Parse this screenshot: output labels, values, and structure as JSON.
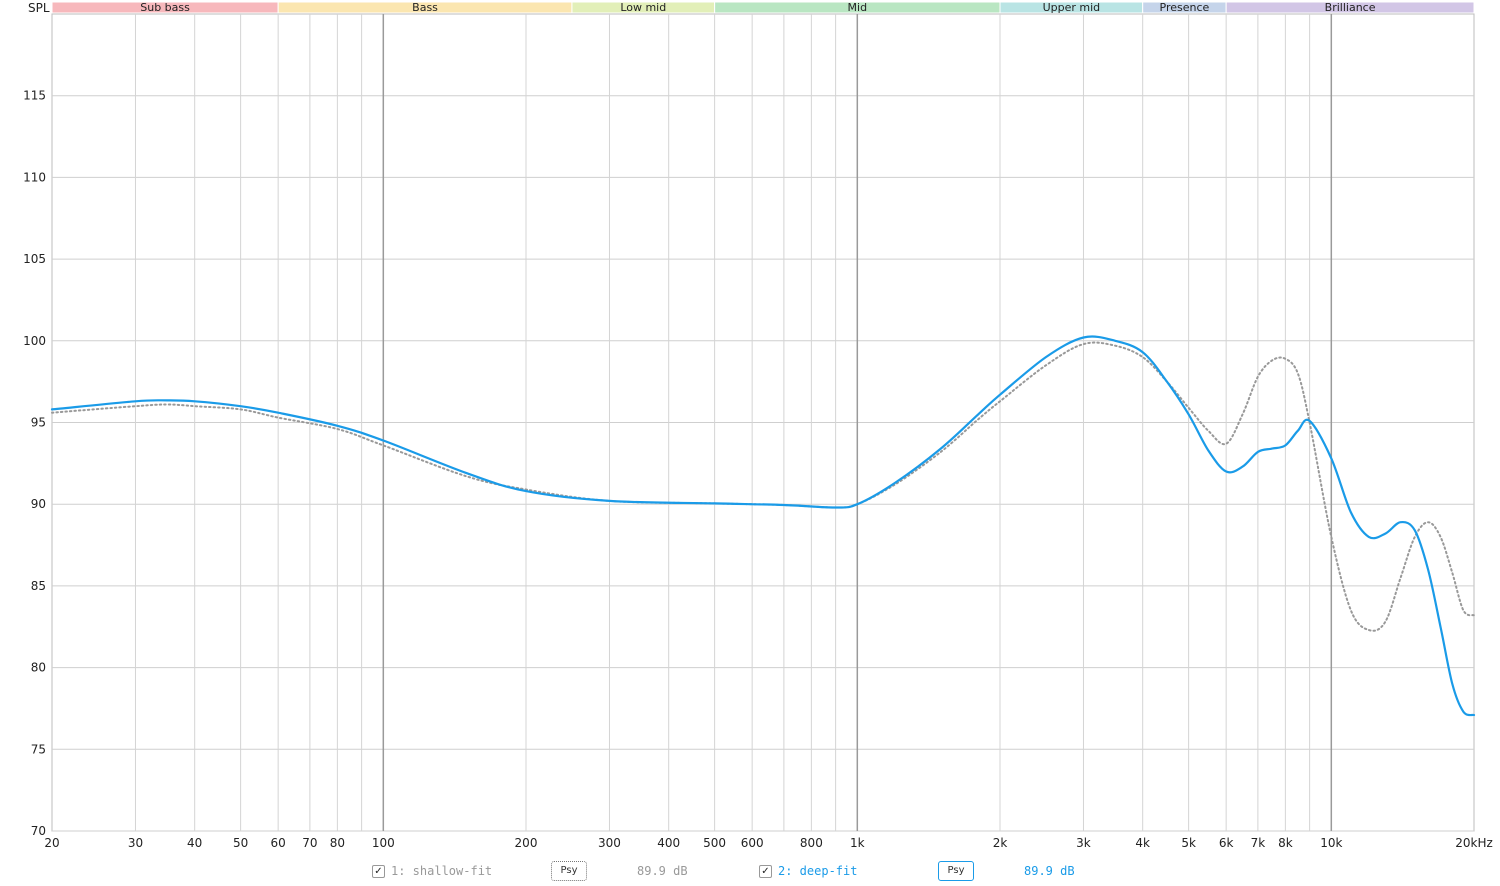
{
  "chart_data": {
    "type": "line",
    "ylabel": "SPL",
    "x_scale": "log",
    "xlim": [
      20,
      20000
    ],
    "ylim": [
      70,
      120
    ],
    "grid": true,
    "y_ticks": [
      70,
      75,
      80,
      85,
      90,
      95,
      100,
      105,
      110,
      115
    ],
    "x_ticks": [
      {
        "value": 20,
        "label": "20"
      },
      {
        "value": 30,
        "label": "30"
      },
      {
        "value": 40,
        "label": "40"
      },
      {
        "value": 50,
        "label": "50"
      },
      {
        "value": 60,
        "label": "60"
      },
      {
        "value": 70,
        "label": "70"
      },
      {
        "value": 80,
        "label": "80"
      },
      {
        "value": 100,
        "label": "100"
      },
      {
        "value": 200,
        "label": "200"
      },
      {
        "value": 300,
        "label": "300"
      },
      {
        "value": 400,
        "label": "400"
      },
      {
        "value": 500,
        "label": "500"
      },
      {
        "value": 600,
        "label": "600"
      },
      {
        "value": 800,
        "label": "800"
      },
      {
        "value": 1000,
        "label": "1k"
      },
      {
        "value": 2000,
        "label": "2k"
      },
      {
        "value": 3000,
        "label": "3k"
      },
      {
        "value": 4000,
        "label": "4k"
      },
      {
        "value": 5000,
        "label": "5k"
      },
      {
        "value": 6000,
        "label": "6k"
      },
      {
        "value": 7000,
        "label": "7k"
      },
      {
        "value": 8000,
        "label": "8k"
      },
      {
        "value": 10000,
        "label": "10k"
      },
      {
        "value": 20000,
        "label": "20kHz"
      }
    ],
    "bands": [
      {
        "label": "Sub bass",
        "from": 20,
        "to": 60,
        "color": "#f7b8bc"
      },
      {
        "label": "Bass",
        "from": 60,
        "to": 250,
        "color": "#fbe6b0"
      },
      {
        "label": "Low mid",
        "from": 250,
        "to": 500,
        "color": "#e2efb8"
      },
      {
        "label": "Mid",
        "from": 500,
        "to": 2000,
        "color": "#b9e6c2"
      },
      {
        "label": "Upper mid",
        "from": 2000,
        "to": 4000,
        "color": "#b9e4e4"
      },
      {
        "label": "Presence",
        "from": 4000,
        "to": 6000,
        "color": "#c5d4ea"
      },
      {
        "label": "Brilliance",
        "from": 6000,
        "to": 20000,
        "color": "#d2c6e6"
      }
    ],
    "series": [
      {
        "name": "1: shallow-fit",
        "color": "#999999",
        "style": "dotted",
        "points": [
          [
            20,
            95.6
          ],
          [
            30,
            96.0
          ],
          [
            35,
            96.1
          ],
          [
            40,
            96.0
          ],
          [
            50,
            95.8
          ],
          [
            60,
            95.3
          ],
          [
            80,
            94.6
          ],
          [
            100,
            93.6
          ],
          [
            150,
            91.7
          ],
          [
            200,
            90.9
          ],
          [
            300,
            90.2
          ],
          [
            500,
            90.05
          ],
          [
            700,
            89.95
          ],
          [
            900,
            89.8
          ],
          [
            1000,
            90.0
          ],
          [
            1200,
            91.2
          ],
          [
            1500,
            93.2
          ],
          [
            1800,
            95.2
          ],
          [
            2000,
            96.3
          ],
          [
            2500,
            98.5
          ],
          [
            3000,
            99.8
          ],
          [
            3500,
            99.7
          ],
          [
            4000,
            99.0
          ],
          [
            4500,
            97.5
          ],
          [
            5000,
            95.9
          ],
          [
            5500,
            94.5
          ],
          [
            6000,
            93.7
          ],
          [
            6500,
            95.5
          ],
          [
            7000,
            97.8
          ],
          [
            7500,
            98.8
          ],
          [
            8000,
            98.9
          ],
          [
            8500,
            98.0
          ],
          [
            9000,
            95.0
          ],
          [
            10000,
            88.0
          ],
          [
            11000,
            83.5
          ],
          [
            12000,
            82.3
          ],
          [
            13000,
            82.8
          ],
          [
            14000,
            85.5
          ],
          [
            15000,
            88.0
          ],
          [
            16000,
            88.9
          ],
          [
            17000,
            88.0
          ],
          [
            18000,
            85.8
          ],
          [
            19000,
            83.5
          ],
          [
            20000,
            83.2
          ]
        ]
      },
      {
        "name": "2: deep-fit",
        "color": "#1a9be8",
        "style": "solid",
        "points": [
          [
            20,
            95.8
          ],
          [
            30,
            96.3
          ],
          [
            35,
            96.35
          ],
          [
            40,
            96.3
          ],
          [
            50,
            96.0
          ],
          [
            60,
            95.6
          ],
          [
            80,
            94.8
          ],
          [
            100,
            93.9
          ],
          [
            150,
            91.9
          ],
          [
            200,
            90.8
          ],
          [
            300,
            90.2
          ],
          [
            500,
            90.05
          ],
          [
            700,
            89.95
          ],
          [
            900,
            89.8
          ],
          [
            1000,
            90.0
          ],
          [
            1200,
            91.3
          ],
          [
            1500,
            93.4
          ],
          [
            1800,
            95.5
          ],
          [
            2000,
            96.7
          ],
          [
            2500,
            99.0
          ],
          [
            3000,
            100.2
          ],
          [
            3500,
            100.0
          ],
          [
            4000,
            99.3
          ],
          [
            4500,
            97.5
          ],
          [
            5000,
            95.5
          ],
          [
            5500,
            93.3
          ],
          [
            6000,
            92.0
          ],
          [
            6500,
            92.3
          ],
          [
            7000,
            93.2
          ],
          [
            7500,
            93.4
          ],
          [
            8000,
            93.6
          ],
          [
            8500,
            94.5
          ],
          [
            9000,
            95.1
          ],
          [
            10000,
            92.8
          ],
          [
            11000,
            89.5
          ],
          [
            12000,
            88.0
          ],
          [
            13000,
            88.2
          ],
          [
            14000,
            88.9
          ],
          [
            15000,
            88.4
          ],
          [
            16000,
            86.0
          ],
          [
            17000,
            82.5
          ],
          [
            18000,
            79.0
          ],
          [
            19000,
            77.3
          ],
          [
            20000,
            77.1
          ]
        ]
      }
    ]
  },
  "legend": [
    {
      "check": "✓",
      "name": "1: shallow-fit",
      "psy": "Psy",
      "value": "89.9 dB",
      "color": "#999999"
    },
    {
      "check": "✓",
      "name": "2: deep-fit",
      "psy": "Psy",
      "value": "89.9 dB",
      "color": "#1a9be8"
    }
  ]
}
